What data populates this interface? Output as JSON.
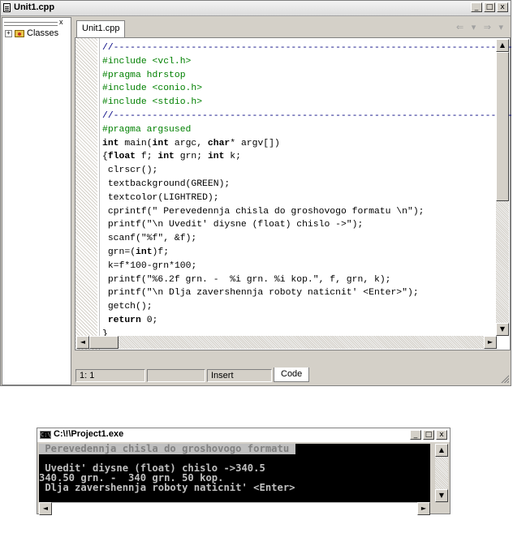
{
  "ide": {
    "title": "Unit1.cpp",
    "window_buttons": [
      "_",
      "□",
      "x"
    ],
    "tree_close": "x",
    "tree_expand": "+",
    "tree_label": "Classes",
    "tab_label": "Unit1.cpp",
    "nav_arrows": "⇐ ▾ ⇒ ▾",
    "status_position": "1:  1",
    "status_mode": "Insert",
    "code_tab": "Code"
  },
  "code_lines": [
    "//---------------------------------------------------------------------------",
    "#include <vcl.h>",
    "#pragma hdrstop",
    "#include <conio.h>",
    "#include <stdio.h>",
    "//---------------------------------------------------------------------------",
    "#pragma argsused",
    "int main(int argc, char* argv[])",
    "{float f; int grn; int k;",
    " clrscr();",
    " textbackground(GREEN);",
    " textcolor(LIGHTRED);",
    " cprintf(\" Perevedennja chisla do groshovogo formatu \\n\");",
    " printf(\"\\n Uvedit' diysne (float) chislo ->\");",
    " scanf(\"%f\", &f);",
    " grn=(int)f;",
    " k=f*100-grn*100;",
    " printf(\"%6.2f grn. -  %i grn. %i kop.\", f, grn, k);",
    " printf(\"\\n Dlja zavershennja roboty naticnit' <Enter>\");",
    " getch();",
    " return 0;",
    "}"
  ],
  "console": {
    "title": "C:\\!\\Project1.exe",
    "window_buttons": [
      "_",
      "□",
      "x"
    ],
    "lines": [
      " Perevedennja chisla do groshovogo formatu ",
      "",
      " Uvedit' diysne (float) chislo ->340.5",
      "340.50 grn. -  340 grn. 50 kop.",
      " Dlja zavershennja roboty naticnit' <Enter>"
    ]
  }
}
